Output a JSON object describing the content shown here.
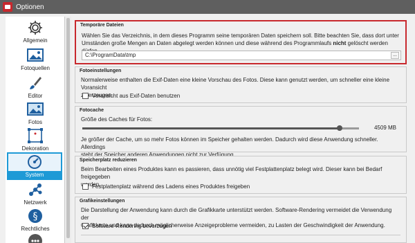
{
  "window": {
    "title": "Optionen",
    "icon": "app-logo-icon"
  },
  "sidebar": {
    "items": [
      {
        "label": "Allgemein",
        "icon": "gear-icon"
      },
      {
        "label": "Fotoquellen",
        "icon": "photo-icon"
      },
      {
        "label": "Editor",
        "icon": "brush-icon"
      },
      {
        "label": "Fotos",
        "icon": "image-icon"
      },
      {
        "label": "Dekoration",
        "icon": "frame-icon"
      },
      {
        "label": "System",
        "icon": "speedometer-icon",
        "active": true
      },
      {
        "label": "Netzwerk",
        "icon": "network-icon"
      },
      {
        "label": "Rechtliches",
        "icon": "paragraph-icon"
      }
    ]
  },
  "groups": {
    "temp": {
      "title": "Temporäre Dateien",
      "text_line1": "Wählen Sie das Verzeichnis, in dem dieses Programm seine temporären Daten speichern soll. Bitte beachten Sie, dass dort unter",
      "text_line2_a": "Umständen große Mengen an Daten abgelegt werden können und diese während des Programmlaufs ",
      "text_line2_bold": "nicht",
      "text_line2_b": " gelöscht werden dürfen.",
      "path_value": "C:\\ProgramData\\tmp",
      "browse_label": "..."
    },
    "foto": {
      "title": "Fotoeinstellungen",
      "text_line1": "Normalerweise enthalten die Exif-Daten eine kleine Vorschau des Fotos. Diese kann genutzt werden, um schneller eine kleine Voransicht",
      "text_line2": "zu erzeugen.",
      "checkbox_label": "Voransicht aus Exif-Daten benutzen",
      "checkbox_checked": false
    },
    "cache": {
      "title": "Fotocache",
      "size_label": "Größe des Caches für Fotos:",
      "slider_value": "4509 MB",
      "slider_fraction": 0.93,
      "text_line1": "Je größer der Cache, um so mehr Fotos können im Speicher gehalten werden. Dadurch wird diese Anwendung schneller. Allerdings",
      "text_line2": "steht der Speicher anderen Anwendungen nicht zur Verfügung."
    },
    "reduce": {
      "title": "Speicherplatz reduzieren",
      "text_line1": "Beim Bearbeiten eines Produktes kann es passieren, dass unnötig viel Festplattenplatz belegt wird. Dieser kann bei Bedarf freigegeben",
      "text_line2": "werden.",
      "checkbox_label": "Festplattenplatz während des Ladens eines Produktes freigeben",
      "checkbox_checked": false
    },
    "graphics": {
      "title": "Grafikeinstellungen",
      "text_line1": "Die Darstellung der Anwendung kann durch die Grafikkarte unterstützt werden. Software-Rendering vermeidet die Verwendung der",
      "text_line2": "Grafikkarte und kann dadurch möglicherweise Anzeigeprobleme vermeiden, zu Lasten der Geschwindigkeit der Anwendung.",
      "checkbox_label": "Software-Rendering bevorzugen",
      "checkbox_checked": true
    }
  },
  "colors": {
    "highlight": "#c8282d",
    "accent": "#1e9ad6",
    "titlebar": "#5f5f5f"
  }
}
